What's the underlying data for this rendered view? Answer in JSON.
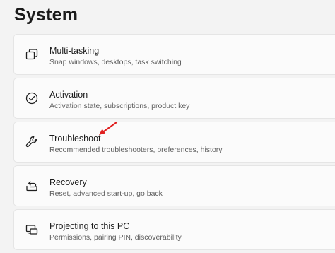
{
  "page": {
    "title": "System"
  },
  "items": [
    {
      "title": "Multi-tasking",
      "subtitle": "Snap windows, desktops, task switching",
      "icon": "multitasking-icon"
    },
    {
      "title": "Activation",
      "subtitle": "Activation state, subscriptions, product key",
      "icon": "activation-check-icon"
    },
    {
      "title": "Troubleshoot",
      "subtitle": "Recommended troubleshooters, preferences, history",
      "icon": "wrench-icon"
    },
    {
      "title": "Recovery",
      "subtitle": "Reset, advanced start-up, go back",
      "icon": "recovery-icon"
    },
    {
      "title": "Projecting to this PC",
      "subtitle": "Permissions, pairing PIN, discoverability",
      "icon": "projecting-icon"
    }
  ],
  "annotation": {
    "arrow_color": "#e02020"
  }
}
